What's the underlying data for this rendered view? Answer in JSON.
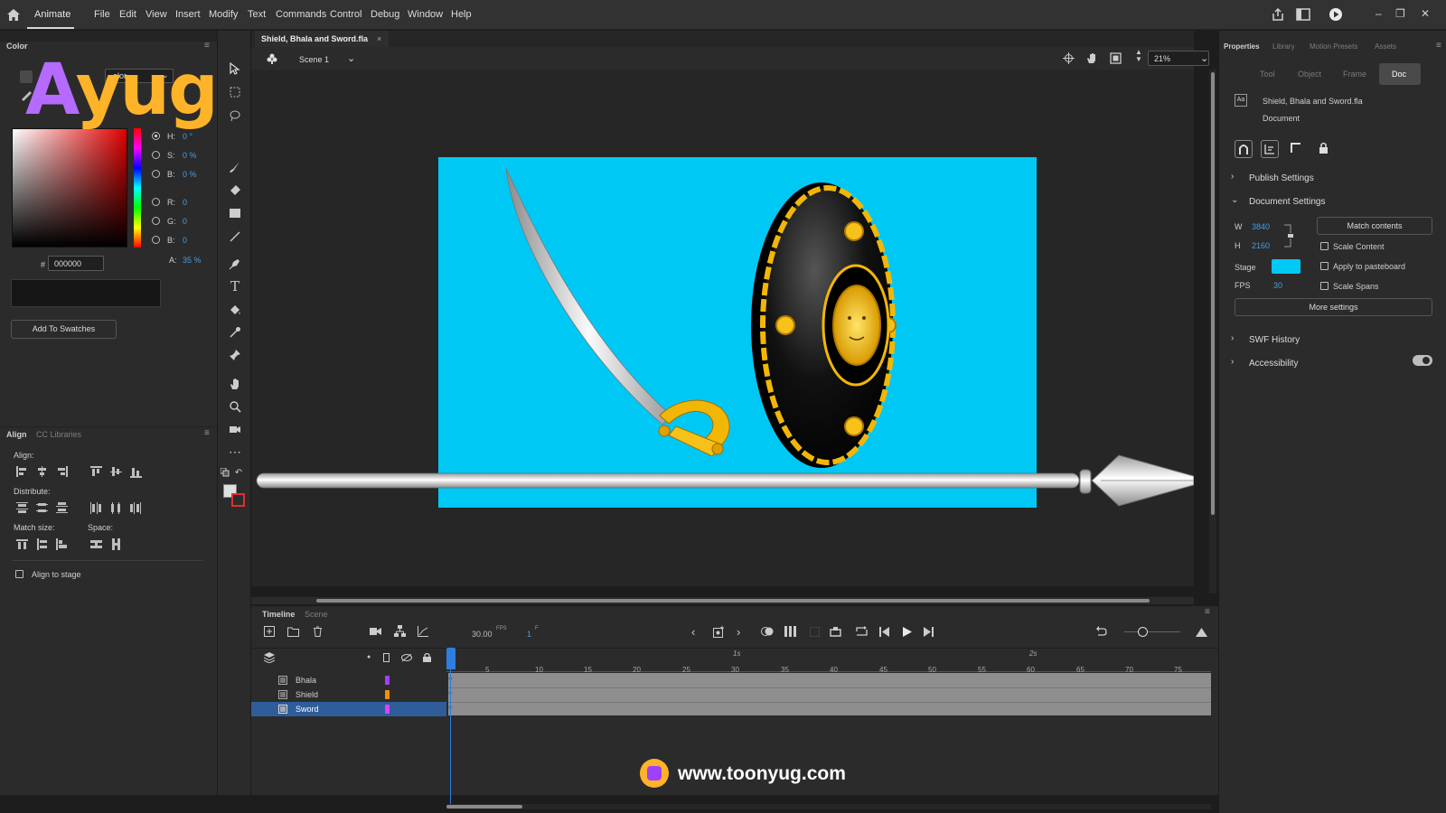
{
  "app": {
    "name": "Animate",
    "menu": [
      "File",
      "Edit",
      "View",
      "Insert",
      "Modify",
      "Text",
      "Commands",
      "Control",
      "Debug",
      "Window",
      "Help"
    ]
  },
  "document": {
    "tab_title": "Shield, Bhala and Sword.fla",
    "scene": "Scene 1",
    "zoom": "21%"
  },
  "color_panel": {
    "title": "Color",
    "type_select": "olor",
    "hsb": [
      {
        "label": "H:",
        "value": "0 °"
      },
      {
        "label": "S:",
        "value": "0 %"
      },
      {
        "label": "B:",
        "value": "0 %"
      }
    ],
    "rgb": [
      {
        "label": "R:",
        "value": "0"
      },
      {
        "label": "G:",
        "value": "0"
      },
      {
        "label": "B:",
        "value": "0"
      }
    ],
    "alpha_label": "A:",
    "alpha_value": "35 %",
    "hex_label": "#",
    "hex_value": "000000",
    "add_swatch": "Add To Swatches"
  },
  "align_panel": {
    "tabs": [
      "Align",
      "CC Libraries"
    ],
    "align_label": "Align:",
    "distribute_label": "Distribute:",
    "match_label": "Match size:",
    "space_label": "Space:",
    "align_to_stage": "Align to stage"
  },
  "timeline": {
    "tabs": [
      "Timeline",
      "Scene"
    ],
    "fps_value": "30.00",
    "fps_unit": "FPS",
    "frame_value": "1",
    "frame_unit": "F",
    "sec_markers": [
      "1s",
      "2s"
    ],
    "ruler": [
      "5",
      "10",
      "15",
      "20",
      "25",
      "30",
      "35",
      "40",
      "45",
      "50",
      "55",
      "60",
      "65",
      "70",
      "75"
    ],
    "layers": [
      {
        "name": "Bhala",
        "color": "#a040ff",
        "selected": false
      },
      {
        "name": "Shield",
        "color": "#ff8c00",
        "selected": false
      },
      {
        "name": "Sword",
        "color": "#e040ff",
        "selected": true
      }
    ]
  },
  "properties": {
    "tabs": [
      "Properties",
      "Library",
      "Motion Presets",
      "Assets"
    ],
    "subtabs": [
      "Tool",
      "Object",
      "Frame",
      "Doc"
    ],
    "doc_name": "Shield, Bhala and Sword.fla",
    "doc_type": "Document",
    "publish_settings": "Publish Settings",
    "document_settings": "Document Settings",
    "w_label": "W",
    "w_value": "3840",
    "h_label": "H",
    "h_value": "2160",
    "match_contents": "Match contents",
    "scale_content": "Scale Content",
    "apply_pasteboard": "Apply to pasteboard",
    "scale_spans": "Scale Spans",
    "stage_label": "Stage",
    "stage_color": "#00c8f5",
    "fps_label": "FPS",
    "fps_value": "30",
    "more_settings": "More settings",
    "swf_history": "SWF History",
    "accessibility": "Accessibility"
  },
  "watermark": {
    "logo_text": "Ayug",
    "url": "www.toonyug.com"
  }
}
